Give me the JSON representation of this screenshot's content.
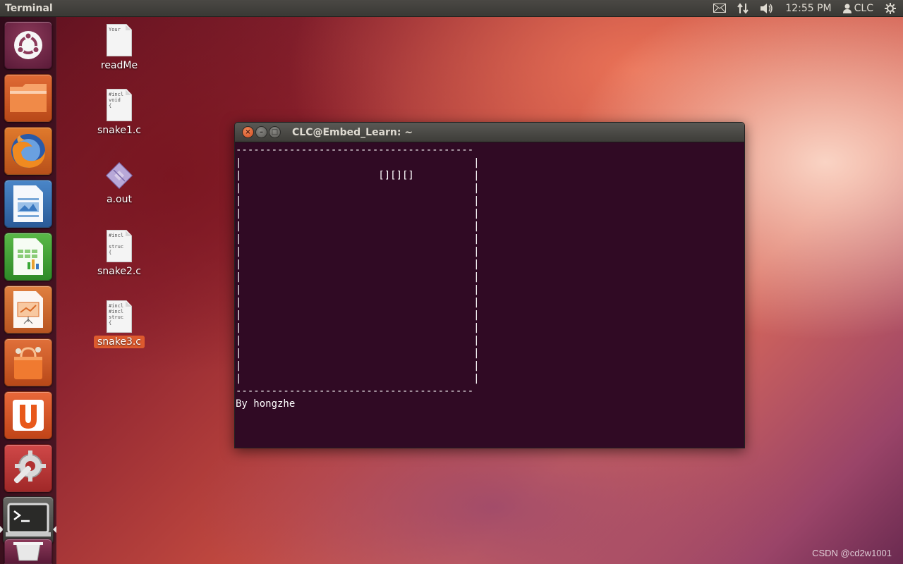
{
  "top_panel": {
    "app_title": "Terminal",
    "time": "12:55 PM",
    "user": "CLC",
    "icons": [
      "mail-icon",
      "network-icon",
      "volume-icon",
      "user-icon",
      "power-icon"
    ]
  },
  "launcher": {
    "items": [
      {
        "name": "dash-home",
        "icon": "ubuntu-logo-icon"
      },
      {
        "name": "files",
        "icon": "folder-icon"
      },
      {
        "name": "firefox",
        "icon": "firefox-icon"
      },
      {
        "name": "libreoffice-writer",
        "icon": "writer-icon"
      },
      {
        "name": "libreoffice-calc",
        "icon": "calc-icon"
      },
      {
        "name": "libreoffice-impress",
        "icon": "impress-icon"
      },
      {
        "name": "software-center",
        "icon": "shopping-bag-icon"
      },
      {
        "name": "ubuntu-one",
        "icon": "ubuntu-one-icon"
      },
      {
        "name": "system-settings",
        "icon": "settings-icon"
      },
      {
        "name": "terminal",
        "icon": "terminal-icon"
      },
      {
        "name": "trash",
        "icon": "trash-icon"
      }
    ]
  },
  "desktop": {
    "icons": [
      {
        "label": "readMe",
        "thumb": "Your",
        "selected": false
      },
      {
        "label": "snake1.c",
        "thumb": "#incl\nvoid\n{",
        "selected": false
      },
      {
        "label": "a.out",
        "thumb": "",
        "selected": false
      },
      {
        "label": "snake2.c",
        "thumb": "#incl\n\nstruc\n{",
        "selected": false
      },
      {
        "label": "snake3.c",
        "thumb": "#incl\n#incl\nstruc\n{",
        "selected": true
      }
    ]
  },
  "terminal": {
    "title": "CLC@Embed_Learn: ~",
    "content": "----------------------------------------\n|                                       |\n|                       [][][]          |\n|                                       |\n|                                       |\n|                                       |\n|                                       |\n|                                       |\n|                                       |\n|                                       |\n|                                       |\n|                                       |\n|                                       |\n|                                       |\n|                                       |\n|                                       |\n|                                       |\n|                                       |\n|                                       |\n----------------------------------------\nBy hongzhe"
  },
  "watermark": "CSDN @cd2w1001"
}
